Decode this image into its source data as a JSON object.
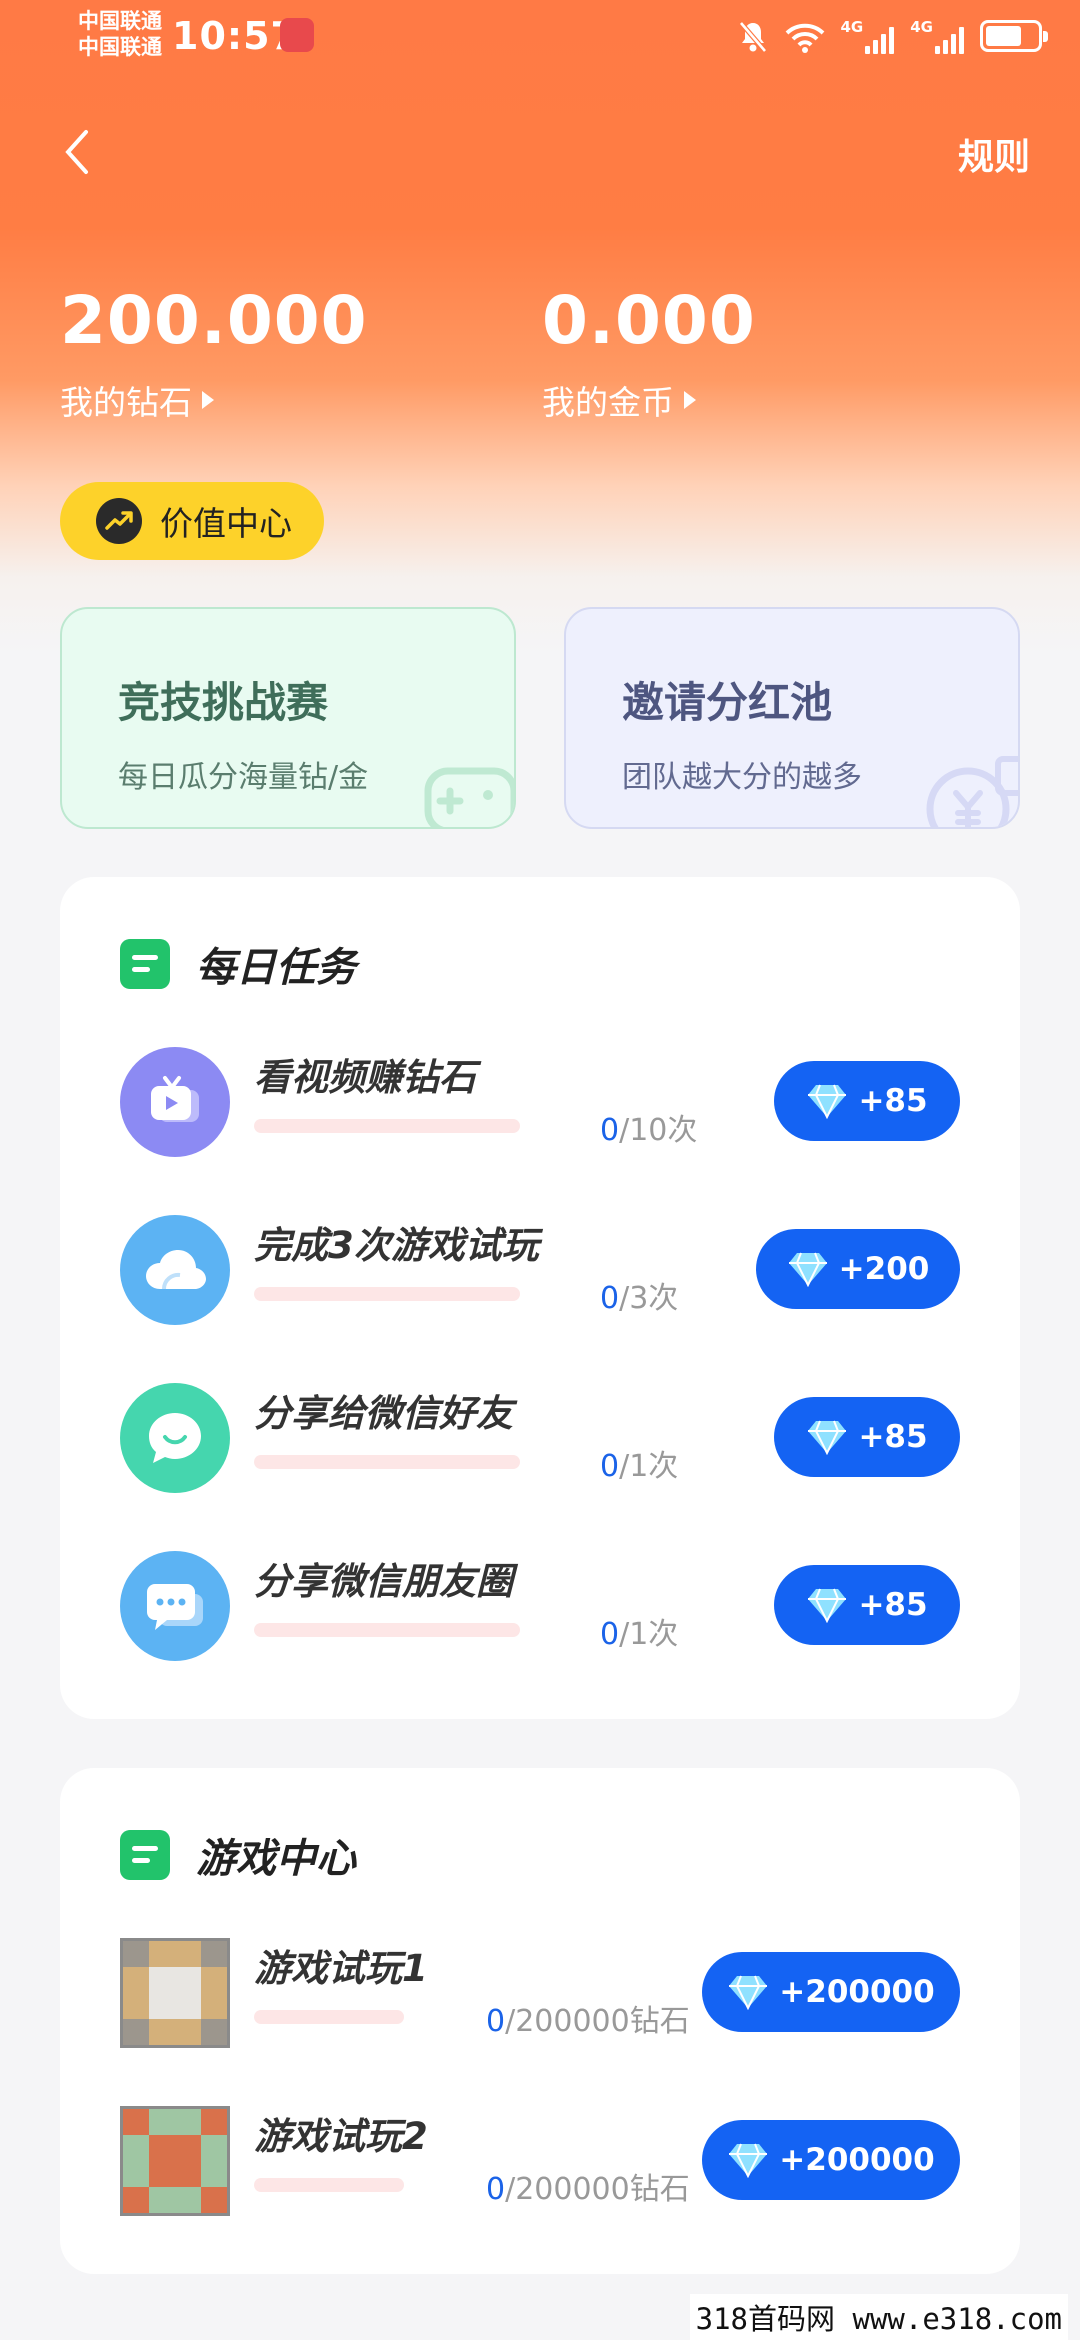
{
  "status_bar": {
    "carrier_1": "中国联通",
    "carrier_2": "中国联通",
    "time": "10:57",
    "network_1": "4G",
    "network_2": "4G"
  },
  "nav": {
    "back_icon": "chevron-left-icon",
    "rules_label": "规则"
  },
  "balances": {
    "diamonds_value": "200.000",
    "diamonds_label": "我的钻石",
    "coins_value": "0.000",
    "coins_label": "我的金币"
  },
  "value_center": {
    "label": "价值中心",
    "icon": "trending-up-icon"
  },
  "promos": {
    "arena": {
      "title": "竞技挑战赛",
      "subtitle": "每日瓜分海量钻/金",
      "icon": "gamepad-icon"
    },
    "invite": {
      "title": "邀请分红池",
      "subtitle": "团队越大分的越多",
      "icon": "yen-coin-icon"
    }
  },
  "daily_tasks": {
    "title": "每日任务",
    "items": [
      {
        "name": "看视频赚钻石",
        "current": "0",
        "total": "/10次",
        "reward": "+85",
        "progress": 0,
        "icon": "tv-play-icon"
      },
      {
        "name": "完成3次游戏试玩",
        "current": "0",
        "total": "/3次",
        "reward": "+200",
        "progress": 0,
        "icon": "cloud-icon"
      },
      {
        "name": "分享给微信好友",
        "current": "0",
        "total": "/1次",
        "reward": "+85",
        "progress": 0,
        "icon": "chat-smile-icon"
      },
      {
        "name": "分享微信朋友圈",
        "current": "0",
        "total": "/1次",
        "reward": "+85",
        "progress": 0,
        "icon": "chat-dots-icon"
      }
    ]
  },
  "game_center": {
    "title": "游戏中心",
    "items": [
      {
        "name": "游戏试玩1",
        "current": "0",
        "total": "/200000钻石",
        "reward": "+200000",
        "progress": 0
      },
      {
        "name": "游戏试玩2",
        "current": "0",
        "total": "/200000钻石",
        "reward": "+200000",
        "progress": 0
      }
    ]
  },
  "watermark": "318首码网 www.e318.com",
  "colors": {
    "header": "#ff7a45",
    "reward_button": "#1463f3",
    "progress_track": "#fde6e6",
    "accent_green": "#22c36b",
    "pill_yellow": "#fdd22a"
  }
}
